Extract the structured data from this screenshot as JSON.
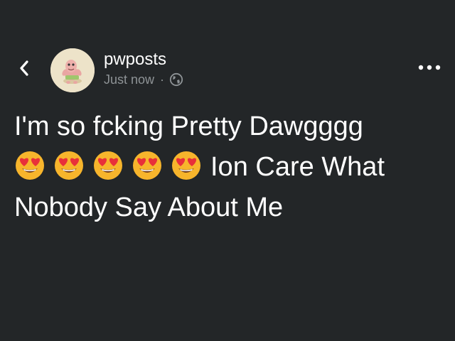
{
  "header": {
    "username": "pwposts",
    "timestamp": "Just now",
    "separator": "·",
    "back_icon": "chevron-left-icon",
    "visibility_icon": "globe-icon",
    "more_icon": "ellipsis-horizontal-icon"
  },
  "post": {
    "line1": "I'm so fcking Pretty Dawgggg",
    "emoji_name": "smiling-face-with-heart-eyes-emoji",
    "emoji_count": 5,
    "line2_text": "Ion Care What",
    "line3": "Nobody Say About Me"
  },
  "colors": {
    "background": "#232628",
    "text": "#ffffff",
    "muted": "#8e9396",
    "avatar_bg": "#ede3c9",
    "emoji_face": "#f7b52c",
    "emoji_heart": "#e8303a"
  }
}
